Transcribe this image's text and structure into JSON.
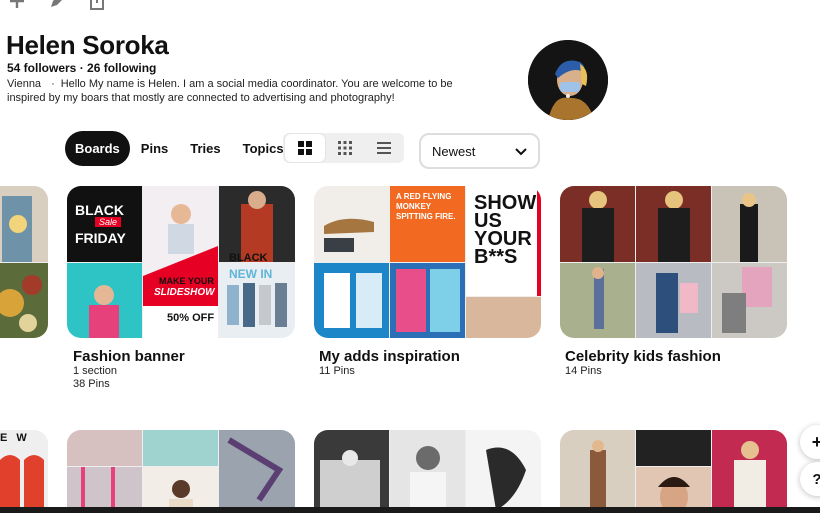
{
  "profile": {
    "name": "Helen Soroka",
    "stats": "54 followers · 26 following",
    "location": "Vienna",
    "separator": "·",
    "bio": "Hello My name is Helen. I am a social media coordinator. You are welcome to be inspired by my boars that mostly are connected to advertising and photography!"
  },
  "tabs": [
    {
      "label": "Boards",
      "active": true
    },
    {
      "label": "Pins"
    },
    {
      "label": "Tries"
    },
    {
      "label": "Topics"
    }
  ],
  "view_modes": [
    "grid-large-icon",
    "grid-small-icon",
    "list-icon"
  ],
  "sort": {
    "selected": "Newest"
  },
  "boards": [
    {
      "title": "Fashion banner",
      "meta_line1": "1 section",
      "meta_line2": "38 Pins"
    },
    {
      "title": "My adds inspiration",
      "meta_line1": "11 Pins",
      "meta_line2": ""
    },
    {
      "title": "Celebrity kids fashion",
      "meta_line1": "14 Pins",
      "meta_line2": ""
    }
  ],
  "cover_text": {
    "black_friday_1": "BLACK",
    "black_friday_sale": "Sale",
    "black_friday_2": "FRIDAY",
    "slideshow_1": "MAKE YOUR",
    "slideshow_2": "SLIDESHOW",
    "discount": "50% OFF",
    "new_in_1": "BLACK",
    "new_in_2": "NEW IN",
    "monkey": "A RED FLYING MONKEY SPITTING FIRE.",
    "show_1": "SHOW",
    "show_2": "US",
    "show_3": "YOUR",
    "show_4": "B**S",
    "new_partial": "E W"
  },
  "fabs": {
    "add": "+",
    "help": "?"
  },
  "colors": {
    "accent_black": "#111111",
    "sale_red": "#e60023",
    "monkey_orange": "#f26a21",
    "cyan": "#1fb6c9"
  }
}
